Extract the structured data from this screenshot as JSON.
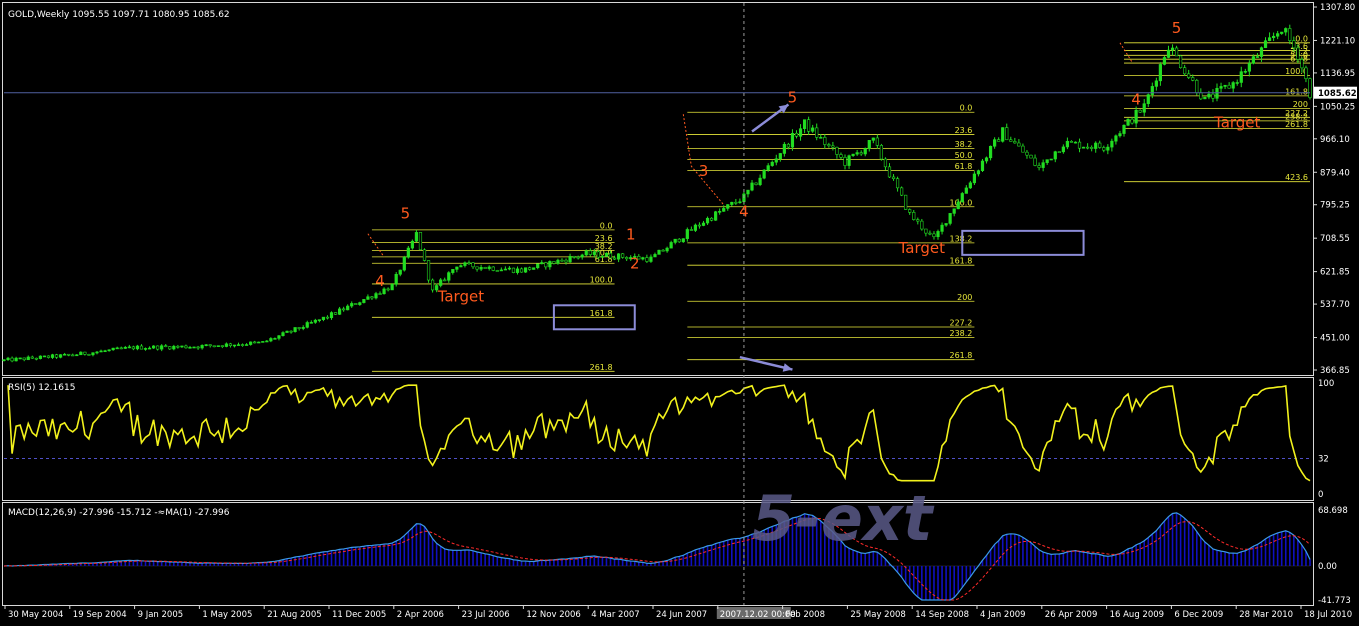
{
  "colors": {
    "background": "#000000",
    "frame": "#d8d8d8",
    "candle": "#22dd22",
    "fib": "#e8e83a",
    "wave_label": "#ff5a1e",
    "target_label": "#ff5a1e",
    "rsi_line": "#f2f21c",
    "rsi_level": "#5050c8",
    "macd_hist": "#1010c0",
    "macd_line": "#3a9ae8",
    "signal_line": "#ff2a2a",
    "box": "#8c8cd8",
    "arrow": "#8c8cd8",
    "price_line": "#5060a0",
    "watermark": "#5a5a88",
    "crosshair_label_bg": "#6a6a6a"
  },
  "chart_data": [
    {
      "type": "candlestick",
      "header": "GOLD,Weekly  1095.55 1097.71 1080.95 1085.62",
      "ylim": [
        366.85,
        1307.8
      ],
      "y_tick_labels": [
        "1307.80",
        "1221.10",
        "1136.95",
        "1050.25",
        "966.10",
        "879.40",
        "795.25",
        "708.55",
        "621.85",
        "537.70",
        "451.00",
        "366.85"
      ],
      "current_price_label": "1085.62",
      "x_tick_labels": [
        "30 May 2004",
        "19 Sep 2004",
        "9 Jan 2005",
        "1 May 2005",
        "21 Aug 2005",
        "11 Dec 2005",
        "2 Apr 2006",
        "23 Jul 2006",
        "12 Nov 2006",
        "4 Mar 2007",
        "24 Jun 2007",
        "2007.12.02 00:00",
        "Feb 2008",
        "25 May 2008",
        "14 Sep 2008",
        "4 Jan 2009",
        "26 Apr 2009",
        "16 Aug 2009",
        "6 Dec 2009",
        "28 Mar 2010",
        "18 Jul 2010"
      ],
      "close_path": [
        [
          "2004-05-30",
          392
        ],
        [
          "2004-09-19",
          405
        ],
        [
          "2005-01-09",
          425
        ],
        [
          "2005-05-01",
          428
        ],
        [
          "2005-08-21",
          438
        ],
        [
          "2005-12-11",
          505
        ],
        [
          "2006-04-02",
          585
        ],
        [
          "2006-05-14",
          720
        ],
        [
          "2006-06-11",
          570
        ],
        [
          "2006-07-23",
          640
        ],
        [
          "2006-11-12",
          625
        ],
        [
          "2007-03-04",
          668
        ],
        [
          "2007-06-24",
          655
        ],
        [
          "2007-09-16",
          745
        ],
        [
          "2007-12-02",
          815
        ],
        [
          "2008-01-27",
          920
        ],
        [
          "2008-03-16",
          1005
        ],
        [
          "2008-05-25",
          905
        ],
        [
          "2008-07-13",
          960
        ],
        [
          "2008-09-14",
          770
        ],
        [
          "2008-10-26",
          705
        ],
        [
          "2009-01-04",
          875
        ],
        [
          "2009-02-22",
          985
        ],
        [
          "2009-04-26",
          890
        ],
        [
          "2009-06-07",
          955
        ],
        [
          "2009-08-16",
          945
        ],
        [
          "2009-10-25",
          1050
        ],
        [
          "2009-12-06",
          1210
        ],
        [
          "2010-02-07",
          1065
        ],
        [
          "2010-03-28",
          1110
        ],
        [
          "2010-06-20",
          1255
        ],
        [
          "2010-07-18",
          1185
        ],
        [
          "2010-08-08",
          1085
        ]
      ],
      "fib_sets": [
        {
          "start": "2006-02-26",
          "end": "2007-04-22",
          "label_at": "2007-04-22",
          "levels": [
            [
              0.0,
              "0.0"
            ],
            [
              23.6,
              "23.6"
            ],
            [
              38.2,
              "38.2"
            ],
            [
              50.0,
              "50.0"
            ],
            [
              61.8,
              "61.8"
            ],
            [
              100.0,
              "100.0"
            ],
            [
              161.8,
              "161.8"
            ],
            [
              261.8,
              "261.8"
            ]
          ],
          "top": 730,
          "bottom": 590
        },
        {
          "start": "2007-08-26",
          "end": "2009-01-04",
          "label_at": "2009-01-04",
          "levels": [
            [
              0.0,
              "0.0"
            ],
            [
              23.6,
              "23.6"
            ],
            [
              38.2,
              "38.2"
            ],
            [
              50.0,
              "50.0"
            ],
            [
              61.8,
              "61.8"
            ],
            [
              100.0,
              "100.0"
            ],
            [
              138.2,
              "138.2"
            ],
            [
              161.8,
              "161.8"
            ],
            [
              200,
              "200"
            ],
            [
              227.2,
              "227.2"
            ],
            [
              238.2,
              "238.2"
            ],
            [
              261.8,
              "261.8"
            ]
          ],
          "top": 1035,
          "bottom": 790
        },
        {
          "start": "2009-09-20",
          "end": "2010-08-08",
          "label_at": "2010-08-08",
          "levels": [
            [
              0.0,
              "0.0"
            ],
            [
              23.6,
              "23.6"
            ],
            [
              38.2,
              "38.2"
            ],
            [
              50.0,
              "50.0"
            ],
            [
              61.8,
              "61.8"
            ],
            [
              100.0,
              "100.0"
            ],
            [
              161.8,
              "161.8"
            ],
            [
              200,
              "200"
            ],
            [
              227.2,
              "227.2"
            ],
            [
              238.2,
              "238.2"
            ],
            [
              261.8,
              "261.8"
            ],
            [
              423.6,
              "423.6"
            ]
          ],
          "top": 1215,
          "bottom": 1130
        }
      ],
      "wave_labels": [
        {
          "text": "5",
          "date": "2006-04-25",
          "price": 760
        },
        {
          "text": "4",
          "date": "2006-03-12",
          "price": 585
        },
        {
          "text": "1",
          "date": "2007-05-20",
          "price": 705
        },
        {
          "text": "2",
          "date": "2007-05-27",
          "price": 630
        },
        {
          "text": "3",
          "date": "2007-09-23",
          "price": 870
        },
        {
          "text": "4",
          "date": "2007-12-02",
          "price": 765
        },
        {
          "text": "5",
          "date": "2008-02-24",
          "price": 1060
        },
        {
          "text": "5",
          "date": "2009-12-20",
          "price": 1240
        },
        {
          "text": "4",
          "date": "2009-10-11",
          "price": 1055
        }
      ],
      "targets": [
        {
          "text": "Target",
          "date": "2006-07-30",
          "price": 545
        },
        {
          "text": "Target",
          "date": "2008-10-05",
          "price": 670
        },
        {
          "text": "Target",
          "date": "2010-04-04",
          "price": 995
        }
      ]
    },
    {
      "type": "line",
      "header": "RSI(5) 12.1615",
      "ylim": [
        0,
        100
      ],
      "y_tick_labels": [
        "100",
        "32",
        "0"
      ],
      "level": 32
    },
    {
      "type": "histogram+line",
      "header": "MACD(12,26,9) -27.996 -15.712  -≈MA(1) -27.996",
      "y_tick_labels": [
        "68.698",
        "0.00",
        "-41.773"
      ],
      "ylim": [
        -41.773,
        68.698
      ]
    }
  ],
  "watermark": "5-ext"
}
